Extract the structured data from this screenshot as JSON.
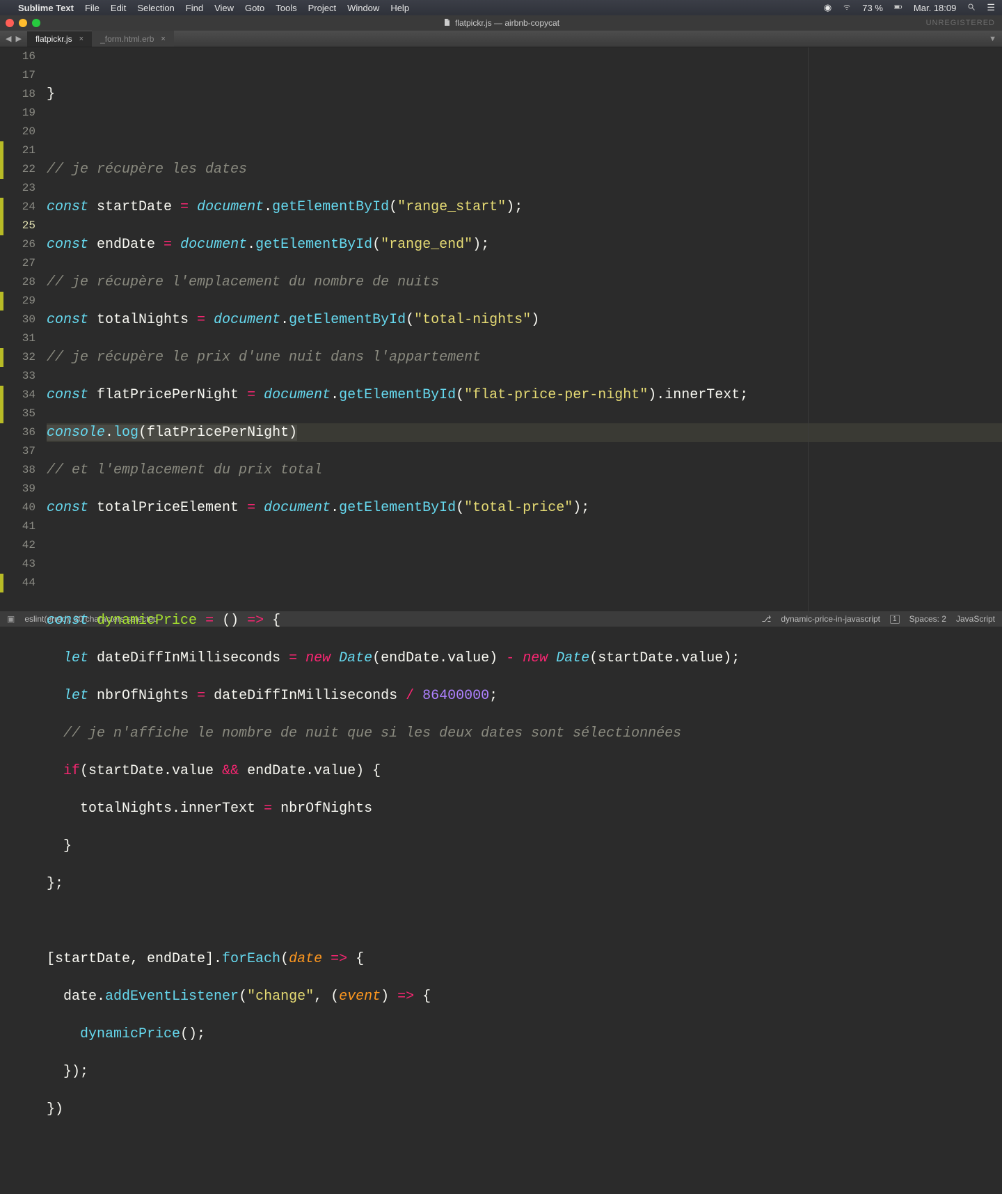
{
  "menubar": {
    "app_name": "Sublime Text",
    "items": [
      "File",
      "Edit",
      "Selection",
      "Find",
      "View",
      "Goto",
      "Tools",
      "Project",
      "Window",
      "Help"
    ],
    "battery": "73 %",
    "clock": "Mar. 18:09"
  },
  "window": {
    "title": "flatpickr.js — airbnb-copycat",
    "unregistered": "UNREGISTERED"
  },
  "tabs": [
    {
      "label": "flatpickr.js",
      "active": true
    },
    {
      "label": "_form.html.erb",
      "active": false
    }
  ],
  "gutter": {
    "start": 16,
    "end": 44,
    "active": 25,
    "modified": [
      21,
      22,
      24,
      25,
      29,
      32,
      34,
      35,
      44
    ]
  },
  "code": {
    "l16": "}",
    "l17": "",
    "l18": "// je récupère les dates",
    "l19": {
      "c1": "const",
      "c2": " startDate ",
      "c3": "=",
      "c4": " ",
      "c5": "document",
      "c6": ".",
      "c7": "getElementById",
      "c8": "(",
      "c9": "\"range_start\"",
      "c10": ");"
    },
    "l20": {
      "c1": "const",
      "c2": " endDate ",
      "c3": "=",
      "c4": " ",
      "c5": "document",
      "c6": ".",
      "c7": "getElementById",
      "c8": "(",
      "c9": "\"range_end\"",
      "c10": ");"
    },
    "l21": "// je récupère l'emplacement du nombre de nuits",
    "l22": {
      "c1": "const",
      "c2": " totalNights ",
      "c3": "=",
      "c4": " ",
      "c5": "document",
      "c6": ".",
      "c7": "getElementById",
      "c8": "(",
      "c9": "\"total-nights\"",
      "c10": ")"
    },
    "l23": "// je récupère le prix d'une nuit dans l'appartement",
    "l24": {
      "c1": "const",
      "c2": " flatPricePerNight ",
      "c3": "=",
      "c4": " ",
      "c5": "document",
      "c6": ".",
      "c7": "getElementById",
      "c8": "(",
      "c9": "\"flat-price-per-night\"",
      "c10": ").innerText;"
    },
    "l25": {
      "c1": "console",
      "c2": ".",
      "c3": "log",
      "c4": "(flatPricePerNight)"
    },
    "l26": "// et l'emplacement du prix total",
    "l27": {
      "c1": "const",
      "c2": " totalPriceElement ",
      "c3": "=",
      "c4": " ",
      "c5": "document",
      "c6": ".",
      "c7": "getElementById",
      "c8": "(",
      "c9": "\"total-price\"",
      "c10": ");"
    },
    "l28": "",
    "l29": "",
    "l30": {
      "c1": "const",
      "c2": " ",
      "c3": "dynamicPrice",
      "c4": " ",
      "c5": "=",
      "c6": " () ",
      "c7": "=>",
      "c8": " {"
    },
    "l31": {
      "i": "  ",
      "c1": "let",
      "c2": " dateDiffInMilliseconds ",
      "c3": "=",
      "c4": " ",
      "c5": "new",
      "c6": " ",
      "c7": "Date",
      "c8": "(endDate.value) ",
      "c9": "-",
      "c10": " ",
      "c11": "new",
      "c12": " ",
      "c13": "Date",
      "c14": "(startDate.value);"
    },
    "l32": {
      "i": "  ",
      "c1": "let",
      "c2": " nbrOfNights ",
      "c3": "=",
      "c4": " dateDiffInMilliseconds ",
      "c5": "/",
      "c6": " ",
      "c7": "86400000",
      "c8": ";"
    },
    "l33": "  // je n'affiche le nombre de nuit que si les deux dates sont sélectionnées",
    "l34": {
      "i": "  ",
      "c1": "if",
      "c2": "(startDate.value ",
      "c3": "&&",
      "c4": " endDate.value) {"
    },
    "l35": "    totalNights.innerText ",
    "l35b": {
      "c1": "=",
      "c2": " nbrOfNights"
    },
    "l36": "  }",
    "l37": "};",
    "l38": "",
    "l39": {
      "c1": "[startDate, endDate].",
      "c2": "forEach",
      "c3": "(",
      "c4": "date",
      "c5": " ",
      "c6": "=>",
      "c7": " {"
    },
    "l40": {
      "i": "  ",
      "c1": "date.",
      "c2": "addEventListener",
      "c3": "(",
      "c4": "\"change\"",
      "c5": ", (",
      "c6": "event",
      "c7": ") ",
      "c8": "=>",
      "c9": " {"
    },
    "l41": {
      "i": "    ",
      "c1": "dynamicPrice",
      "c2": "();"
    },
    "l42": "  });",
    "l43": "})",
    "l44": ""
  },
  "status": {
    "lint": "eslint(erred), 30 characters selected",
    "branch": "dynamic-price-in-javascript",
    "branch_badge": "1",
    "spaces": "Spaces: 2",
    "lang": "JavaScript"
  }
}
